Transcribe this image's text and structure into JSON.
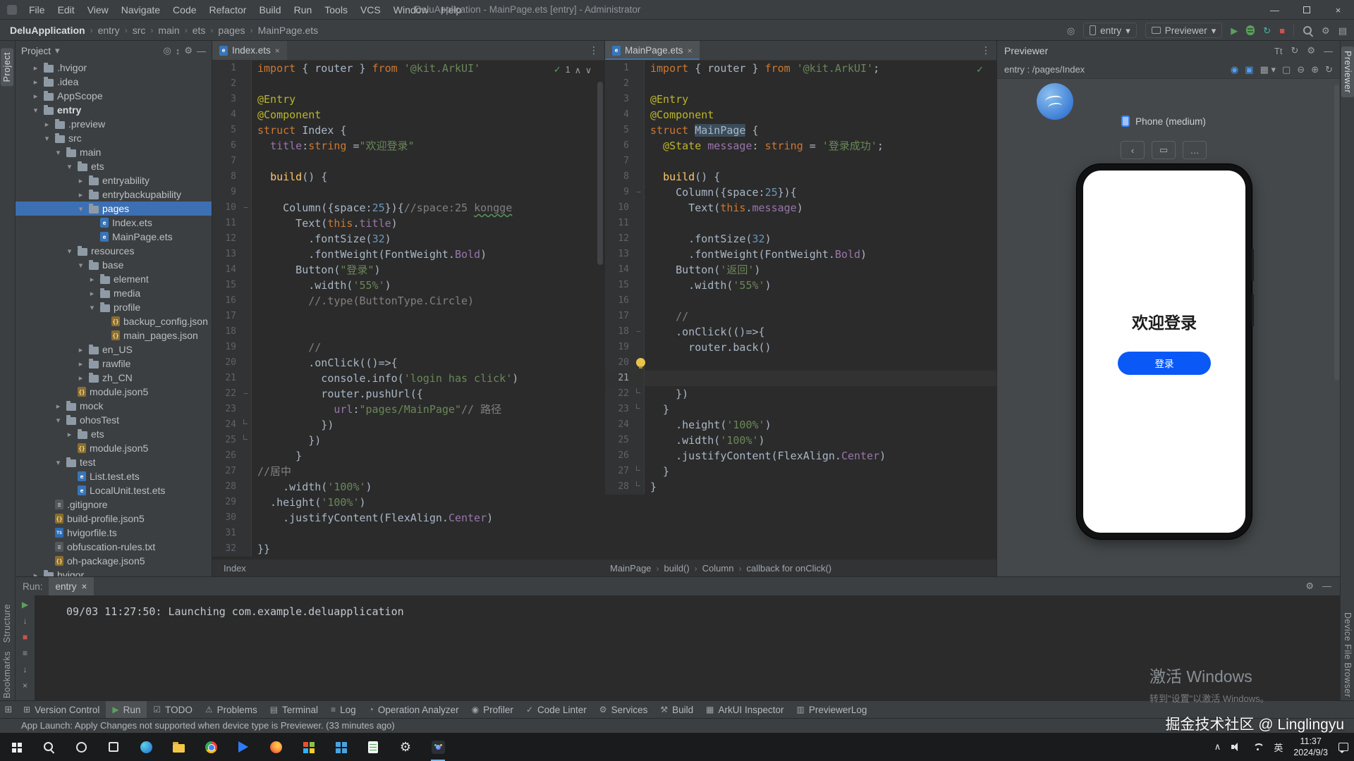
{
  "colors": {
    "accent_blue": "#3b82f6",
    "selection_blue": "#3d6fb3",
    "run_green": "#5c9f5e",
    "stop_red": "#c75450",
    "keyword_orange": "#cc7832",
    "string_green": "#6a8759",
    "comment_gray": "#808080",
    "number_blue": "#6897bb",
    "annotation_yellow": "#bbb529",
    "screen_button_blue": "#0a59f7"
  },
  "window": {
    "title": "DeluApplication - MainPage.ets [entry] - Administrator",
    "menu": [
      "File",
      "Edit",
      "View",
      "Navigate",
      "Code",
      "Refactor",
      "Build",
      "Run",
      "Tools",
      "VCS",
      "Window",
      "Help"
    ]
  },
  "navbar": {
    "breadcrumbs": [
      "DeluApplication",
      "entry",
      "src",
      "main",
      "ets",
      "pages",
      "MainPage.ets"
    ],
    "device": "entry",
    "run_target": "Previewer"
  },
  "left_strip": {
    "project": "Project",
    "structure": "Structure",
    "bookmarks": "Bookmarks"
  },
  "right_strip": {
    "previewer": "Previewer",
    "device_file_browser": "Device File Browser"
  },
  "project": {
    "title": "Project",
    "tree": [
      {
        "label": ".hvigor",
        "level": 1,
        "kind": "folder",
        "chev": "right"
      },
      {
        "label": ".idea",
        "level": 1,
        "kind": "folder",
        "chev": "right"
      },
      {
        "label": "AppScope",
        "level": 1,
        "kind": "folder",
        "chev": "right"
      },
      {
        "label": "entry",
        "level": 1,
        "kind": "folder",
        "chev": "down",
        "bold": true
      },
      {
        "label": ".preview",
        "level": 2,
        "kind": "folder",
        "chev": "right"
      },
      {
        "label": "src",
        "level": 2,
        "kind": "folder",
        "chev": "down"
      },
      {
        "label": "main",
        "level": 3,
        "kind": "folder",
        "chev": "down"
      },
      {
        "label": "ets",
        "level": 4,
        "kind": "folder",
        "chev": "down"
      },
      {
        "label": "entryability",
        "level": 5,
        "kind": "folder",
        "chev": "right"
      },
      {
        "label": "entrybackupability",
        "level": 5,
        "kind": "folder",
        "chev": "right"
      },
      {
        "label": "pages",
        "level": 5,
        "kind": "folder",
        "chev": "down",
        "selected": true
      },
      {
        "label": "Index.ets",
        "level": 6,
        "kind": "ets",
        "chev": "none"
      },
      {
        "label": "MainPage.ets",
        "level": 6,
        "kind": "ets",
        "chev": "none"
      },
      {
        "label": "resources",
        "level": 4,
        "kind": "folder",
        "chev": "down"
      },
      {
        "label": "base",
        "level": 5,
        "kind": "folder",
        "chev": "down"
      },
      {
        "label": "element",
        "level": 6,
        "kind": "folder",
        "chev": "right"
      },
      {
        "label": "media",
        "level": 6,
        "kind": "folder",
        "chev": "right"
      },
      {
        "label": "profile",
        "level": 6,
        "kind": "folder",
        "chev": "down"
      },
      {
        "label": "backup_config.json",
        "level": 7,
        "kind": "json",
        "chev": "none"
      },
      {
        "label": "main_pages.json",
        "level": 7,
        "kind": "json",
        "chev": "none"
      },
      {
        "label": "en_US",
        "level": 5,
        "kind": "folder",
        "chev": "right"
      },
      {
        "label": "rawfile",
        "level": 5,
        "kind": "folder",
        "chev": "right"
      },
      {
        "label": "zh_CN",
        "level": 5,
        "kind": "folder",
        "chev": "right"
      },
      {
        "label": "module.json5",
        "level": 4,
        "kind": "json",
        "chev": "none"
      },
      {
        "label": "mock",
        "level": 3,
        "kind": "folder",
        "chev": "right"
      },
      {
        "label": "ohosTest",
        "level": 3,
        "kind": "folder",
        "chev": "down"
      },
      {
        "label": "ets",
        "level": 4,
        "kind": "folder",
        "chev": "right"
      },
      {
        "label": "module.json5",
        "level": 4,
        "kind": "json",
        "chev": "none"
      },
      {
        "label": "test",
        "level": 3,
        "kind": "folder",
        "chev": "down"
      },
      {
        "label": "List.test.ets",
        "level": 4,
        "kind": "ets",
        "chev": "none"
      },
      {
        "label": "LocalUnit.test.ets",
        "level": 4,
        "kind": "ets",
        "chev": "none"
      },
      {
        "label": ".gitignore",
        "level": 2,
        "kind": "txt",
        "chev": "none"
      },
      {
        "label": "build-profile.json5",
        "level": 2,
        "kind": "json",
        "chev": "none"
      },
      {
        "label": "hvigorfile.ts",
        "level": 2,
        "kind": "ts",
        "chev": "none"
      },
      {
        "label": "obfuscation-rules.txt",
        "level": 2,
        "kind": "txt",
        "chev": "none"
      },
      {
        "label": "oh-package.json5",
        "level": 2,
        "kind": "json",
        "chev": "none"
      },
      {
        "label": "hvigor",
        "level": 1,
        "kind": "folder",
        "chev": "right"
      }
    ]
  },
  "editors": {
    "left": {
      "tab": "Index.ets",
      "inspection_count": "1",
      "breadcrumb": [
        "Index"
      ],
      "folds": [
        10,
        22
      ],
      "fold_ends": [
        24,
        25
      ],
      "lines": [
        [
          [
            "k",
            "import "
          ],
          [
            "p",
            "{ router } "
          ],
          [
            "k",
            "from "
          ],
          [
            "s",
            "'@kit.ArkUI'"
          ]
        ],
        [],
        [
          [
            "a",
            "@Entry"
          ]
        ],
        [
          [
            "a",
            "@Component"
          ]
        ],
        [
          [
            "k",
            "struct "
          ],
          [
            "p",
            "Index {"
          ]
        ],
        [
          [
            "p",
            "  "
          ],
          [
            "v",
            "title"
          ],
          [
            "p",
            ":"
          ],
          [
            "k",
            "string"
          ],
          [
            "p",
            " ="
          ],
          [
            "s",
            "\"欢迎登录\""
          ]
        ],
        [],
        [
          [
            "p",
            "  "
          ],
          [
            "f",
            "build"
          ],
          [
            "p",
            "() {"
          ]
        ],
        [],
        [
          [
            "p",
            "    Column({space:"
          ],
          [
            "n",
            "25"
          ],
          [
            "p",
            "}){"
          ],
          [
            "c",
            "//space:25 "
          ],
          [
            "cu",
            "kongge"
          ]
        ],
        [
          [
            "p",
            "      Text("
          ],
          [
            "k",
            "this"
          ],
          [
            "p",
            "."
          ],
          [
            "v",
            "title"
          ],
          [
            "p",
            ")"
          ]
        ],
        [
          [
            "p",
            "        .fontSize("
          ],
          [
            "n",
            "32"
          ],
          [
            "p",
            ")"
          ]
        ],
        [
          [
            "p",
            "        .fontWeight(FontWeight."
          ],
          [
            "v",
            "Bold"
          ],
          [
            "p",
            ")"
          ]
        ],
        [
          [
            "p",
            "      Button("
          ],
          [
            "s",
            "\"登录\""
          ],
          [
            "p",
            ")"
          ]
        ],
        [
          [
            "p",
            "        .width("
          ],
          [
            "s",
            "'55%'"
          ],
          [
            "p",
            ")"
          ]
        ],
        [
          [
            "c",
            "        //.type(ButtonType.Circle)"
          ]
        ],
        [],
        [],
        [
          [
            "c",
            "        //"
          ]
        ],
        [
          [
            "p",
            "        .onClick(()=>{"
          ]
        ],
        [
          [
            "p",
            "          console.info("
          ],
          [
            "s",
            "'login has click'"
          ],
          [
            "p",
            ")"
          ]
        ],
        [
          [
            "p",
            "          router.pushUrl({"
          ]
        ],
        [
          [
            "p",
            "            "
          ],
          [
            "v",
            "url"
          ],
          [
            "p",
            ":"
          ],
          [
            "s",
            "\"pages/MainPage\""
          ],
          [
            "c",
            "// 路径"
          ]
        ],
        [
          [
            "p",
            "          })"
          ]
        ],
        [
          [
            "p",
            "        })"
          ]
        ],
        [
          [
            "p",
            "      }"
          ]
        ],
        [
          [
            "c",
            "//居中"
          ]
        ],
        [
          [
            "p",
            "    .width("
          ],
          [
            "s",
            "'100%'"
          ],
          [
            "p",
            ")"
          ]
        ],
        [
          [
            "p",
            "  .height("
          ],
          [
            "s",
            "'100%'"
          ],
          [
            "p",
            ")"
          ]
        ],
        [
          [
            "p",
            "    .justifyContent(FlexAlign."
          ],
          [
            "v",
            "Center"
          ],
          [
            "p",
            ")"
          ]
        ],
        [],
        [
          [
            "p",
            "}}"
          ]
        ]
      ]
    },
    "right": {
      "tab": "MainPage.ets",
      "breadcrumb": [
        "MainPage",
        "build()",
        "Column",
        "callback for onClick()"
      ],
      "current_line": 21,
      "bulb_line": 20,
      "folds": [
        9,
        18
      ],
      "fold_ends": [
        22,
        23,
        27,
        28
      ],
      "lines": [
        [
          [
            "k",
            "import "
          ],
          [
            "p",
            "{ router } "
          ],
          [
            "k",
            "from "
          ],
          [
            "s",
            "'@kit.ArkUI'"
          ],
          [
            "p",
            ";"
          ]
        ],
        [],
        [
          [
            "a",
            "@Entry"
          ]
        ],
        [
          [
            "a",
            "@Component"
          ]
        ],
        [
          [
            "k",
            "struct "
          ],
          [
            "h",
            "MainPage"
          ],
          [
            "p",
            " {"
          ]
        ],
        [
          [
            "p",
            "  "
          ],
          [
            "a",
            "@State"
          ],
          [
            "p",
            " "
          ],
          [
            "v",
            "message"
          ],
          [
            "p",
            ": "
          ],
          [
            "k",
            "string"
          ],
          [
            "p",
            " = "
          ],
          [
            "s",
            "'登录成功'"
          ],
          [
            "p",
            ";"
          ]
        ],
        [],
        [
          [
            "p",
            "  "
          ],
          [
            "f",
            "build"
          ],
          [
            "p",
            "() {"
          ]
        ],
        [
          [
            "p",
            "    Column({space:"
          ],
          [
            "n",
            "25"
          ],
          [
            "p",
            "}){"
          ]
        ],
        [
          [
            "p",
            "      Text("
          ],
          [
            "k",
            "this"
          ],
          [
            "p",
            "."
          ],
          [
            "v",
            "message"
          ],
          [
            "p",
            ")"
          ]
        ],
        [],
        [
          [
            "p",
            "      .fontSize("
          ],
          [
            "n",
            "32"
          ],
          [
            "p",
            ")"
          ]
        ],
        [
          [
            "p",
            "      .fontWeight(FontWeight."
          ],
          [
            "v",
            "Bold"
          ],
          [
            "p",
            ")"
          ]
        ],
        [
          [
            "p",
            "    Button("
          ],
          [
            "s",
            "'返回'"
          ],
          [
            "p",
            ")"
          ]
        ],
        [
          [
            "p",
            "      .width("
          ],
          [
            "s",
            "'55%'"
          ],
          [
            "p",
            ")"
          ]
        ],
        [],
        [
          [
            "c",
            "    //"
          ]
        ],
        [
          [
            "p",
            "    .onClick(()=>{"
          ]
        ],
        [
          [
            "p",
            "      router.back()"
          ]
        ],
        [],
        [],
        [
          [
            "p",
            "    })"
          ]
        ],
        [
          [
            "p",
            "  }"
          ]
        ],
        [
          [
            "p",
            "    .height("
          ],
          [
            "s",
            "'100%'"
          ],
          [
            "p",
            ")"
          ]
        ],
        [
          [
            "p",
            "    .width("
          ],
          [
            "s",
            "'100%'"
          ],
          [
            "p",
            ")"
          ]
        ],
        [
          [
            "p",
            "    .justifyContent(FlexAlign."
          ],
          [
            "v",
            "Center"
          ],
          [
            "p",
            ")"
          ]
        ],
        [
          [
            "p",
            "  }"
          ]
        ],
        [
          [
            "p",
            "}"
          ]
        ]
      ]
    }
  },
  "previewer": {
    "title": "Previewer",
    "target": "entry : /pages/Index",
    "device_label": "Phone (medium)",
    "screen_title": "欢迎登录",
    "screen_button": "登录"
  },
  "run_panel": {
    "label": "Run:",
    "tab": "entry",
    "console": "09/03 11:27:50: Launching com.example.deluapplication"
  },
  "toolwindow_bar": {
    "items": [
      {
        "label": "Version Control",
        "glyph": "⊞",
        "icon": "version-control-icon"
      },
      {
        "label": "Run",
        "glyph": "▶",
        "icon": "run-icon",
        "active": true,
        "green": true
      },
      {
        "label": "TODO",
        "glyph": "☑",
        "icon": "todo-icon"
      },
      {
        "label": "Problems",
        "glyph": "⚠",
        "icon": "problems-icon"
      },
      {
        "label": "Terminal",
        "glyph": "▤",
        "icon": "terminal-icon"
      },
      {
        "label": "Log",
        "glyph": "≡",
        "icon": "log-icon"
      },
      {
        "label": "Operation Analyzer",
        "glyph": "◔",
        "icon": "operation-analyzer-icon"
      },
      {
        "label": "Profiler",
        "glyph": "◉",
        "icon": "profiler-icon"
      },
      {
        "label": "Code Linter",
        "glyph": "✓",
        "icon": "code-linter-icon"
      },
      {
        "label": "Services",
        "glyph": "⚙",
        "icon": "services-icon"
      },
      {
        "label": "Build",
        "glyph": "⚒",
        "icon": "build-icon"
      },
      {
        "label": "ArkUI Inspector",
        "glyph": "▦",
        "icon": "arkui-inspector-icon"
      },
      {
        "label": "PreviewerLog",
        "glyph": "▥",
        "icon": "previewerlog-icon"
      }
    ]
  },
  "status_bar": {
    "message": "App Launch: Apply Changes not supported when device type is Previewer. (33 minutes ago)"
  },
  "watermarks": {
    "activate_title": "激活 Windows",
    "activate_sub": "转到\"设置\"以激活 Windows。",
    "community": "掘金技术社区 @ Linglingyu"
  },
  "taskbar": {
    "apps": [
      {
        "name": "start"
      },
      {
        "name": "search"
      },
      {
        "name": "browser"
      },
      {
        "name": "task-view"
      },
      {
        "name": "edge"
      },
      {
        "name": "explorer"
      },
      {
        "name": "chrome"
      },
      {
        "name": "quark"
      },
      {
        "name": "firefox"
      },
      {
        "name": "appstore"
      },
      {
        "name": "office"
      },
      {
        "name": "notes"
      },
      {
        "name": "settings"
      },
      {
        "name": "deveco",
        "active": true
      }
    ],
    "input_indicator": "英",
    "time": "11:37",
    "date": "2024/9/3"
  }
}
